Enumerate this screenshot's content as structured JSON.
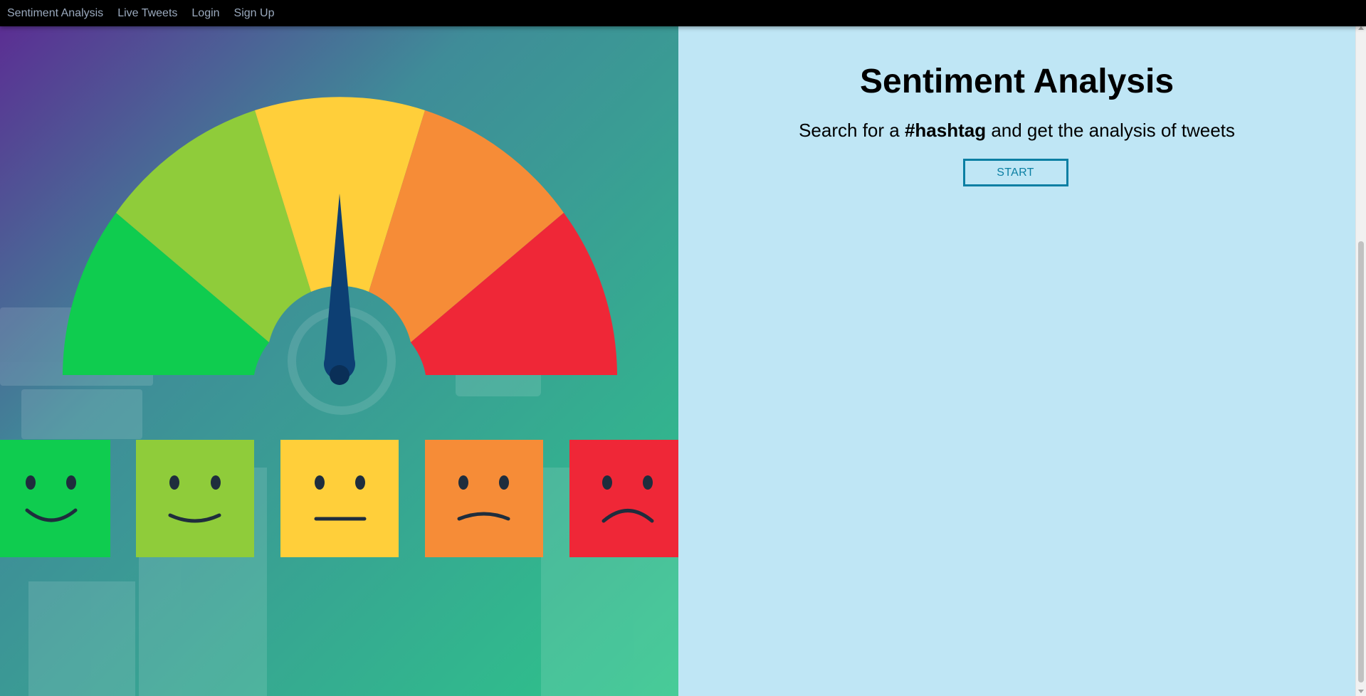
{
  "navbar": {
    "items": [
      {
        "label": "Sentiment Analysis"
      },
      {
        "label": "Live Tweets"
      },
      {
        "label": "Login"
      },
      {
        "label": "Sign Up"
      }
    ]
  },
  "hero": {
    "title": "Sentiment Analysis",
    "subtitle_prefix": "Search for a ",
    "subtitle_hashtag": "#hashtag",
    "subtitle_suffix": " and get the analysis of tweets",
    "start_label": "START"
  },
  "image": {
    "icon": "sentiment-gauge-illustration",
    "faces": [
      "very-happy-face",
      "happy-face",
      "neutral-face",
      "sad-face",
      "very-sad-face"
    ]
  },
  "colors": {
    "navbar_bg": "#000000",
    "nav_link": "#9aa9bd",
    "panel_bg": "#bfe6f5",
    "accent": "#0b7fa3"
  }
}
